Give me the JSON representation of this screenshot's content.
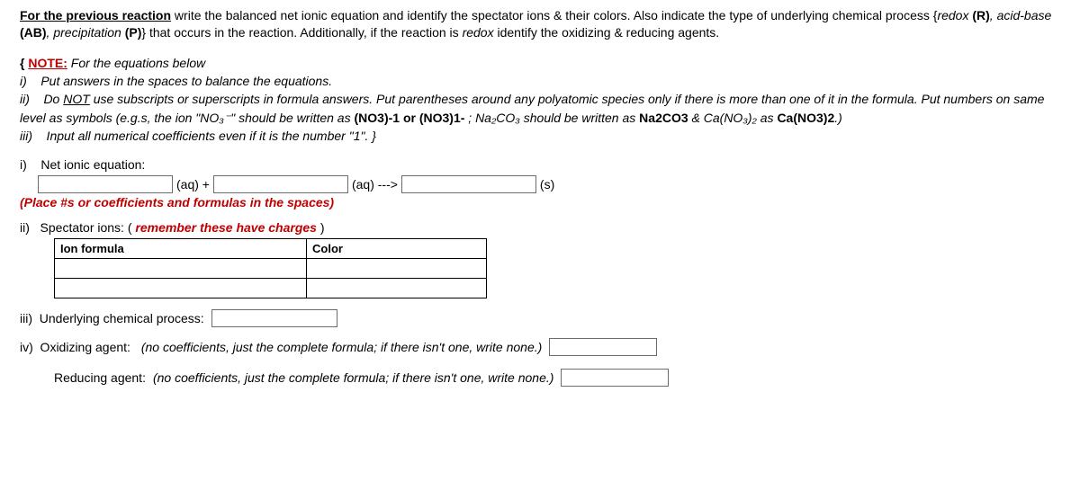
{
  "intro": {
    "lead": "For the previous reaction",
    "body_1": " write the balanced net ionic equation and identify the spectator ions & their colors. Also indicate the type of underlying chemical process {",
    "redox": "redox",
    "r_abbr": " (R)",
    "comma1": ", ",
    "acidbase": "acid-base",
    "ab_abbr": " (AB)",
    "comma2": ", ",
    "precip": "precipitation",
    "p_abbr": " (P)",
    "body_2": "} that occurs in the reaction. Additionally, if the reaction is ",
    "redox2": "redox",
    "body_3": " identify the oxidizing & reducing agents."
  },
  "note": {
    "open_brace": "{ ",
    "label": "NOTE:",
    "for_eq": " For the equations below",
    "i_num": "i)",
    "i_text": "    Put answers in the spaces to balance the equations.",
    "ii_num": "ii)",
    "ii_pre": "    Do ",
    "not_word": "NOT",
    "ii_mid": " use subscripts or superscripts in formula answers. Put parentheses around any polyatomic species only if there is more than one of it in the formula. Put numbers on same level as symbols (e.g.s, the ion \"NO₃⁻\" should be written as ",
    "ex1": "(NO3)-1 or (NO3)1-",
    "ii_sep": " ; Na₂CO₃ should be written as ",
    "ex2": "Na2CO3",
    "amp": " & Ca(NO₃)₂ as ",
    "ex3": "Ca(NO3)2",
    "ii_end": ".)",
    "iii_num": "iii)",
    "iii_text": "    Input all numerical coefficients even if it is the number \"1\". }"
  },
  "part_i": {
    "label": "i)    Net ionic equation:",
    "aq1": "(aq)  +",
    "aq2": "(aq)  --->",
    "s1": "(s)",
    "place": "(Place #s or coefficients and formulas in the spaces)"
  },
  "part_ii": {
    "label_pre": "ii)   Spectator ions: ( ",
    "remember": "remember these have charges",
    "label_post": " )",
    "th1": "Ion formula",
    "th2": "Color"
  },
  "part_iii": {
    "label": "iii)  Underlying chemical process:"
  },
  "part_iv": {
    "label": "iv)  Oxidizing agent: ",
    "hint": "(no coefficients, just the complete formula; if there isn't one, write none.)",
    "reduce_label": "Reducing agent: ",
    "reduce_hint": "(no coefficients, just the complete formula; if there isn't one, write none.)"
  }
}
